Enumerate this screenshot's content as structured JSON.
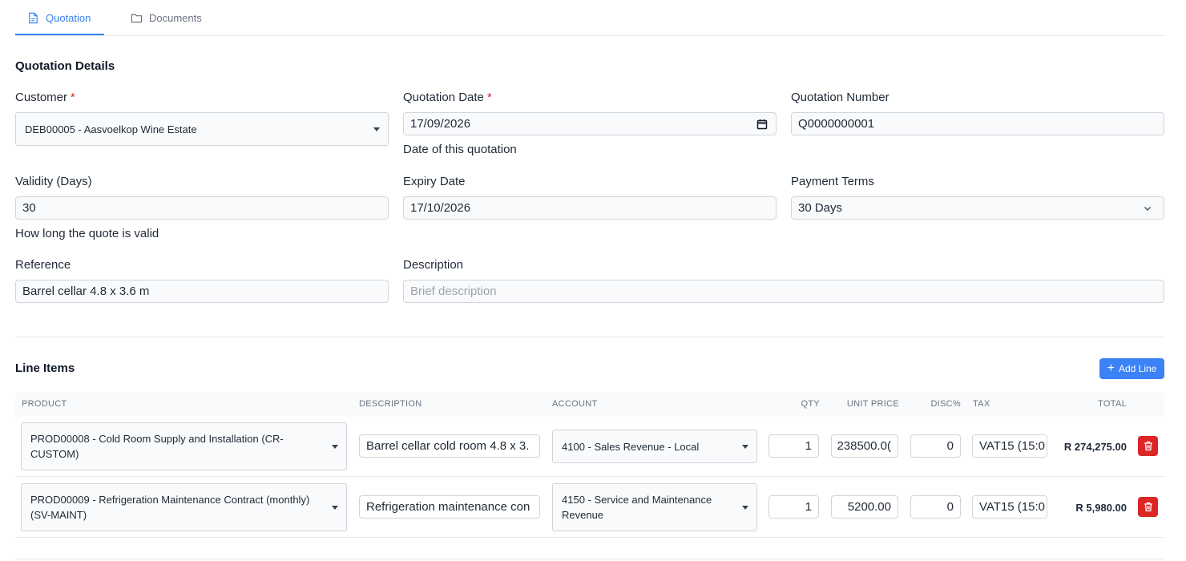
{
  "tabs": [
    {
      "label": "Quotation",
      "icon": "file-icon",
      "active": true
    },
    {
      "label": "Documents",
      "icon": "folder-icon",
      "active": false
    }
  ],
  "details": {
    "title": "Quotation Details",
    "customer": {
      "label": "Customer",
      "required": "*",
      "value": "DEB00005 - Aasvoelkop Wine Estate"
    },
    "quotation_date": {
      "label": "Quotation Date",
      "required": "*",
      "value": "17/09/2026",
      "help": "Date of this quotation"
    },
    "quotation_number": {
      "label": "Quotation Number",
      "value": "Q0000000001"
    },
    "validity": {
      "label": "Validity (Days)",
      "value": "30",
      "help": "How long the quote is valid"
    },
    "expiry_date": {
      "label": "Expiry Date",
      "value": "17/10/2026"
    },
    "payment_terms": {
      "label": "Payment Terms",
      "value": "30 Days"
    },
    "reference": {
      "label": "Reference",
      "value": "Barrel cellar 4.8 x 3.6 m"
    },
    "description": {
      "label": "Description",
      "placeholder": "Brief description"
    }
  },
  "line_items": {
    "title": "Line Items",
    "add_label": "Add Line",
    "columns": {
      "product": "PRODUCT",
      "description": "DESCRIPTION",
      "account": "ACCOUNT",
      "qty": "QTY",
      "unit_price": "UNIT PRICE",
      "disc": "DISC%",
      "tax": "TAX",
      "total": "TOTAL"
    },
    "rows": [
      {
        "product_line1": "PROD00008 - Cold Room Supply and Installation (CR-",
        "product_line2": "CUSTOM)",
        "description": "Barrel cellar cold room 4.8 x 3.",
        "account_line1": "4100 - Sales Revenue - Local",
        "account_line2": "",
        "qty": "1",
        "unit_price": "238500.0(",
        "disc": "0",
        "tax": "VAT15 (15:0",
        "total": "R 274,275.00"
      },
      {
        "product_line1": "PROD00009 - Refrigeration Maintenance Contract (monthly)",
        "product_line2": "(SV-MAINT)",
        "description": "Refrigeration maintenance con",
        "account_line1": "4150 - Service and Maintenance",
        "account_line2": "Revenue",
        "qty": "1",
        "unit_price": "5200.00",
        "disc": "0",
        "tax": "VAT15 (15:0",
        "total": "R 5,980.00"
      }
    ]
  },
  "colors": {
    "accent": "#3b82f6",
    "danger": "#dc2626",
    "required": "#dc2626"
  }
}
